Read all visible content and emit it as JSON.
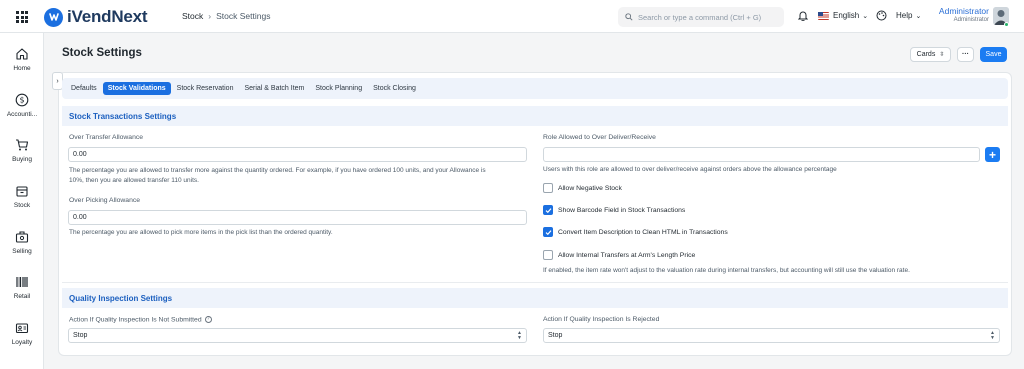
{
  "app": {
    "name": "iVendNext"
  },
  "breadcrumb": {
    "parent": "Stock",
    "current": "Stock Settings"
  },
  "search": {
    "placeholder": "Search or type a command (Ctrl + G)"
  },
  "topbar": {
    "language": "English",
    "help": "Help"
  },
  "user": {
    "name": "Administrator",
    "role": "Administrator"
  },
  "sidebar": {
    "items": [
      {
        "label": "Home",
        "icon": "home-icon"
      },
      {
        "label": "Accounti...",
        "icon": "dollar-icon"
      },
      {
        "label": "Buying",
        "icon": "cart-icon"
      },
      {
        "label": "Stock",
        "icon": "box-icon"
      },
      {
        "label": "Selling",
        "icon": "pos-icon"
      },
      {
        "label": "Retail",
        "icon": "barcode-icon"
      },
      {
        "label": "Loyalty",
        "icon": "id-card-icon"
      }
    ]
  },
  "page": {
    "title": "Stock Settings",
    "cards_label": "Cards",
    "more_label": "···",
    "save_label": "Save"
  },
  "tabs": [
    {
      "label": "Defaults",
      "active": false
    },
    {
      "label": "Stock Validations",
      "active": true
    },
    {
      "label": "Stock Reservation",
      "active": false
    },
    {
      "label": "Serial & Batch Item",
      "active": false
    },
    {
      "label": "Stock Planning",
      "active": false
    },
    {
      "label": "Stock Closing",
      "active": false
    }
  ],
  "stock_transactions": {
    "title": "Stock Transactions Settings",
    "over_transfer": {
      "label": "Over Transfer Allowance",
      "value": "0.00",
      "desc_line1": "The percentage you are allowed to transfer more against the quantity ordered. For example, if you have ordered 100 units, and your Allowance is",
      "desc_line2": "10%, then you are allowed transfer 110 units."
    },
    "over_picking": {
      "label": "Over Picking Allowance",
      "value": "0.00",
      "desc": "The percentage you are allowed to pick more items in the pick list than the ordered quantity."
    },
    "role_over_deliver": {
      "label": "Role Allowed to Over Deliver/Receive",
      "value": "",
      "desc": "Users with this role are allowed to over deliver/receive against orders above the allowance percentage"
    },
    "checkboxes": [
      {
        "label": "Allow Negative Stock",
        "checked": false
      },
      {
        "label": "Show Barcode Field in Stock Transactions",
        "checked": true
      },
      {
        "label": "Convert Item Description to Clean HTML in Transactions",
        "checked": true
      },
      {
        "label": "Allow Internal Transfers at Arm's Length Price",
        "checked": false
      }
    ],
    "internal_transfer_desc": "If enabled, the item rate won't adjust to the valuation rate during internal transfers, but accounting will still use the valuation rate."
  },
  "quality_inspection": {
    "title": "Quality Inspection Settings",
    "not_submitted": {
      "label": "Action If Quality Inspection Is Not Submitted",
      "value": "Stop"
    },
    "rejected": {
      "label": "Action If Quality Inspection Is Rejected",
      "value": "Stop"
    }
  },
  "colors": {
    "primary": "#1b6fe0",
    "save": "#1b7cf2",
    "section_bg": "#eef3fb"
  }
}
